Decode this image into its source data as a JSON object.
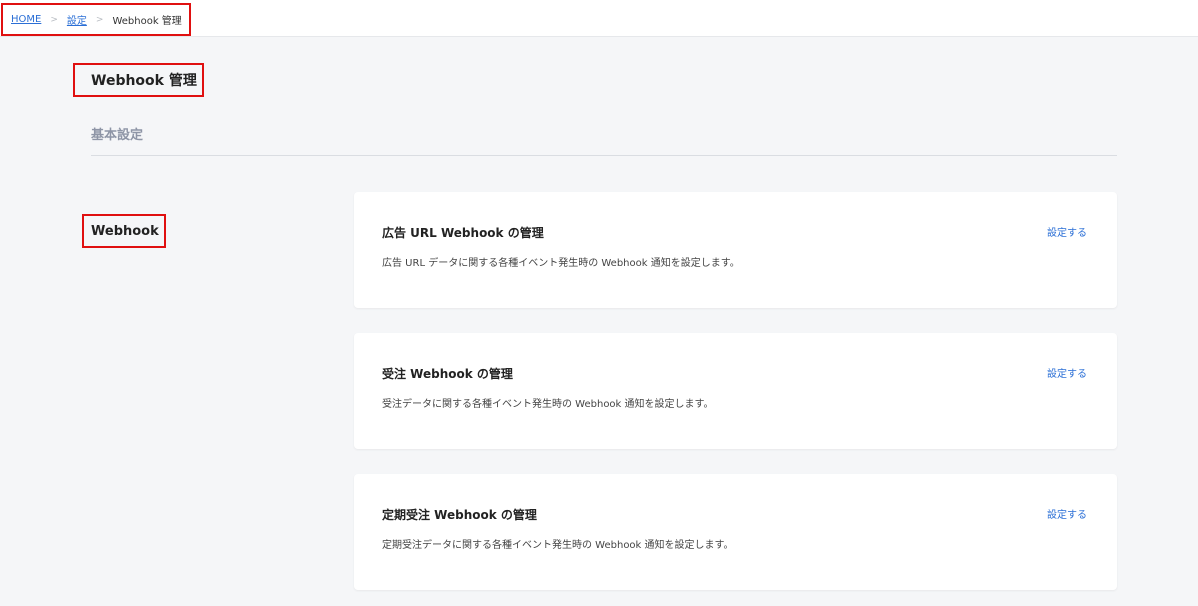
{
  "breadcrumb": {
    "home": "HOME",
    "settings": "設定",
    "separator": ">",
    "current": "Webhook 管理"
  },
  "page": {
    "title": "Webhook 管理",
    "section_title": "基本設定",
    "group_label": "Webhook"
  },
  "cards": [
    {
      "title": "広告 URL Webhook の管理",
      "description": "広告 URL データに関する各種イベント発生時の Webhook 通知を設定します。",
      "action": "設定する"
    },
    {
      "title": "受注 Webhook の管理",
      "description": "受注データに関する各種イベント発生時の Webhook 通知を設定します。",
      "action": "設定する"
    },
    {
      "title": "定期受注 Webhook の管理",
      "description": "定期受注データに関する各種イベント発生時の Webhook 通知を設定します。",
      "action": "設定する"
    }
  ],
  "colors": {
    "link": "#2b6fd6",
    "highlight_border": "#e01010",
    "background": "#f5f6f8"
  }
}
